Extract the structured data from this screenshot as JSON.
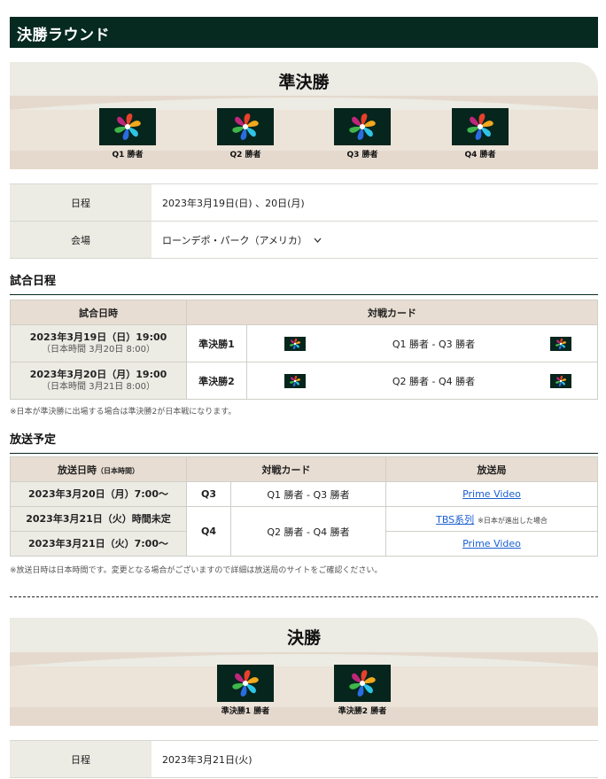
{
  "section_title": "決勝ラウンド",
  "semifinal": {
    "title": "準決勝",
    "teams": [
      "Q1 勝者",
      "Q2 勝者",
      "Q3 勝者",
      "Q4 勝者"
    ],
    "schedule_label": "日程",
    "schedule_value": "2023年3月19日(日) 、20日(月)",
    "venue_label": "会場",
    "venue_value": "ローンデポ・パーク（アメリカ）"
  },
  "game_schedule": {
    "heading": "試合日程",
    "col_datetime": "試合日時",
    "col_matchup": "対戦カード",
    "rows": [
      {
        "date": "2023年3月19日（日）19:00",
        "jp_time": "（日本時間 3月20日 8:00）",
        "round": "準決勝1",
        "matchup": "Q1 勝者 - Q3 勝者"
      },
      {
        "date": "2023年3月20日（月）19:00",
        "jp_time": "（日本時間 3月21日 8:00）",
        "round": "準決勝2",
        "matchup": "Q2 勝者 - Q4 勝者"
      }
    ],
    "note": "※日本が準決勝に出場する場合は準決勝2が日本戦になります。"
  },
  "broadcast": {
    "heading": "放送予定",
    "col_datetime": "放送日時",
    "col_datetime_sub": "（日本時間）",
    "col_matchup": "対戦カード",
    "col_station": "放送局",
    "rows": [
      {
        "date": "2023年3月20日（月）7:00〜",
        "round": "Q3",
        "matchup": "Q1 勝者 - Q3 勝者",
        "station": "Prime Video"
      },
      {
        "date": "2023年3月21日（火）時間未定",
        "round": "Q4",
        "matchup": "Q2 勝者 - Q4 勝者",
        "station": "TBS系列",
        "station_note": "※日本が進出した場合"
      },
      {
        "date": "2023年3月21日（火）7:00〜",
        "station": "Prime Video"
      }
    ],
    "note": "※放送日時は日本時間です。変更となる場合がございますので詳細は放送局のサイトをご確認ください。"
  },
  "final": {
    "title": "決勝",
    "teams": [
      "準決勝1 勝者",
      "準決勝2 勝者"
    ],
    "schedule_label": "日程",
    "schedule_value": "2023年3月21日(火)"
  },
  "colors": {
    "header_bg": "#062920",
    "bracket_bg": "#ecebe4",
    "table_head_bg": "#e8ddd2",
    "link": "#1a5fd1"
  },
  "icons": {
    "team_logo": "wbc-pinwheel-logo-icon",
    "venue_toggle": "chevron-down-icon"
  }
}
